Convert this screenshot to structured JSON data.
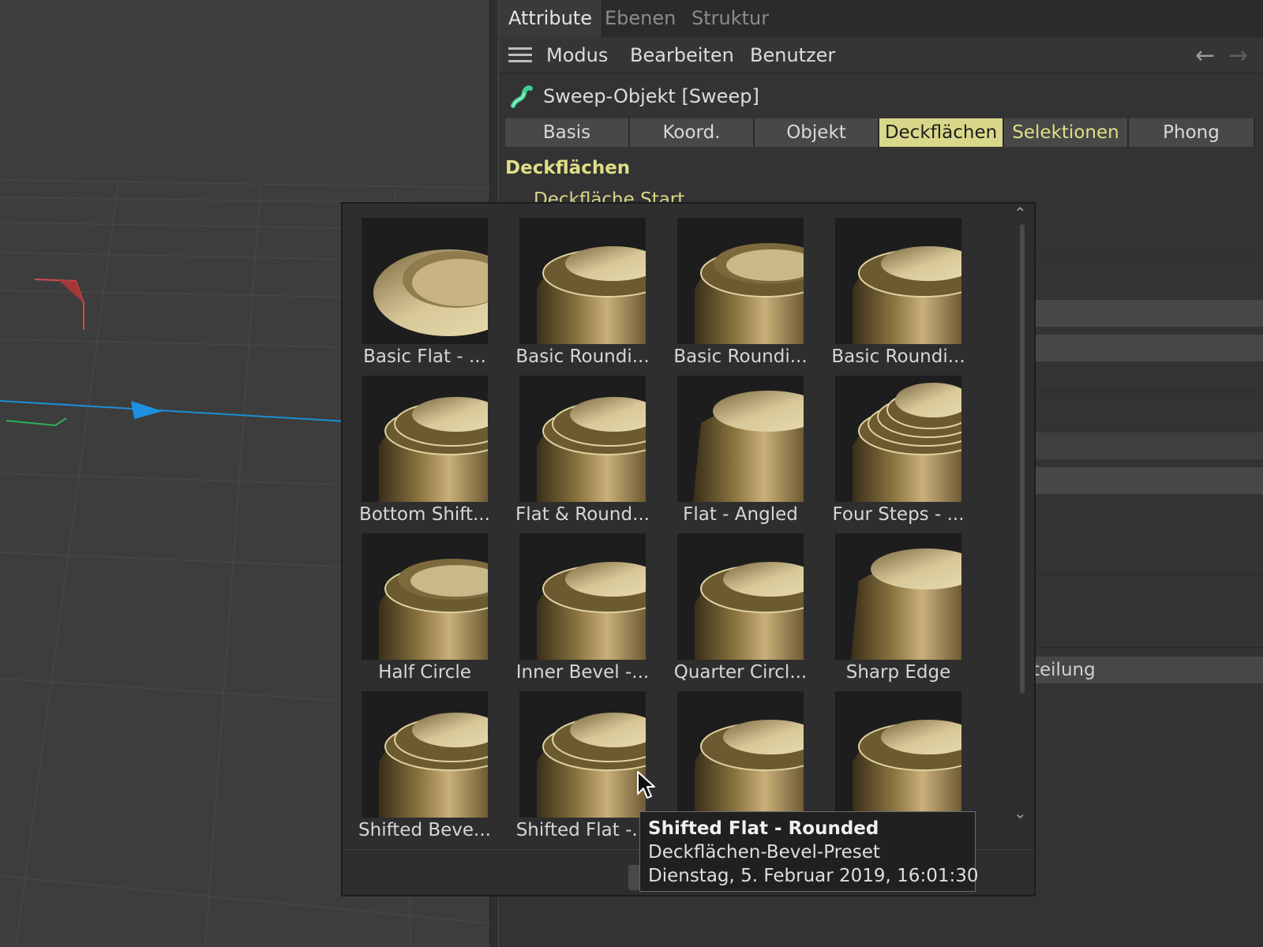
{
  "window_tabs": [
    {
      "label": "Attribute",
      "active": true
    },
    {
      "label": "Ebenen",
      "active": false
    },
    {
      "label": "Struktur",
      "active": false
    }
  ],
  "menu": {
    "items": [
      "Modus",
      "Bearbeiten",
      "Benutzer"
    ],
    "back_icon": "arrow-left-icon",
    "forward_icon": "arrow-right-icon"
  },
  "object": {
    "icon": "sweep-object-icon",
    "title": "Sweep-Objekt [Sweep]"
  },
  "property_tabs": [
    {
      "label": "Basis",
      "state": "normal"
    },
    {
      "label": "Koord.",
      "state": "normal"
    },
    {
      "label": "Objekt",
      "state": "normal"
    },
    {
      "label": "Deckflächen",
      "state": "selected"
    },
    {
      "label": "Selektionen",
      "state": "highlighted"
    },
    {
      "label": "Phong",
      "state": "normal"
    }
  ],
  "section": {
    "title": "Deckflächen",
    "partially_hidden_label": "Deckfläche Start",
    "partially_hidden_field": "teilung"
  },
  "presets": [
    {
      "label": "Basic Flat - ...",
      "style": "flat"
    },
    {
      "label": "Basic Roundi...",
      "style": "round"
    },
    {
      "label": "Basic Roundi...",
      "style": "lip"
    },
    {
      "label": "Basic Roundi...",
      "style": "step"
    },
    {
      "label": "Bottom Shift...",
      "style": "step2"
    },
    {
      "label": "Flat & Round...",
      "style": "step2"
    },
    {
      "label": "Flat - Angled",
      "style": "angled"
    },
    {
      "label": "Four Steps - ...",
      "style": "steps4"
    },
    {
      "label": "Half Circle",
      "style": "lip"
    },
    {
      "label": "Inner Bevel -...",
      "style": "step"
    },
    {
      "label": "Quarter Circl...",
      "style": "round"
    },
    {
      "label": "Sharp Edge",
      "style": "angled"
    },
    {
      "label": "Shifted Beve...",
      "style": "step2"
    },
    {
      "label": "Shifted Flat -...",
      "style": "step2"
    },
    {
      "label": "",
      "style": "step"
    },
    {
      "label": "",
      "style": "step"
    }
  ],
  "tooltip": {
    "title": "Shifted Flat - Rounded",
    "type": "Deckflächen-Bevel-Preset",
    "date": "Dienstag, 5. Februar 2019, 16:01:30"
  },
  "colors": {
    "selected_tab": "#d9d88a",
    "accent_text": "#e0df86",
    "gold": "#b8a068"
  }
}
